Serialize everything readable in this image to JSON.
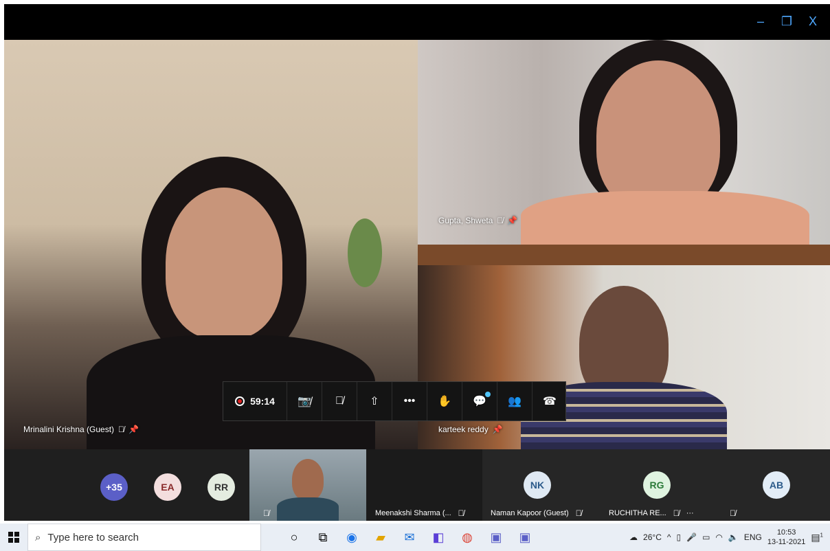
{
  "window": {
    "minimize": "–",
    "restore": "❐",
    "close": "X"
  },
  "tiles": {
    "main": {
      "name": "Mrinalini Krishna (Guest)"
    },
    "top_right": {
      "name": "Gupta, Shweta"
    },
    "bottom_right": {
      "name": "karteek reddy"
    }
  },
  "controls": {
    "timer": "59:14"
  },
  "strip": {
    "avatars": [
      {
        "initials": "+35",
        "bg": "#5b5fc7",
        "fg": "#ffffff"
      },
      {
        "initials": "EA",
        "bg": "#f3dede",
        "fg": "#8a2a2a"
      },
      {
        "initials": "RR",
        "bg": "#e4ece0",
        "fg": "#333333"
      }
    ],
    "participants": [
      {
        "name": "Meenakshi Sharma (..."
      },
      {
        "name": "Naman Kapoor (Guest)",
        "initials": "NK",
        "bg": "#dfe9f3",
        "fg": "#2b5a8a"
      },
      {
        "name": "RUCHITHA RE...",
        "initials": "RG",
        "bg": "#dff3e0",
        "fg": "#2a7a38"
      },
      {
        "name": "",
        "initials": "AB",
        "bg": "#e3edf7",
        "fg": "#2b5a8a"
      }
    ],
    "more": "···"
  },
  "taskbar": {
    "search_placeholder": "Type here to search",
    "temperature": "26°C",
    "language": "ENG",
    "time": "10:53",
    "date": "13-11-2021",
    "notifications": "1"
  }
}
